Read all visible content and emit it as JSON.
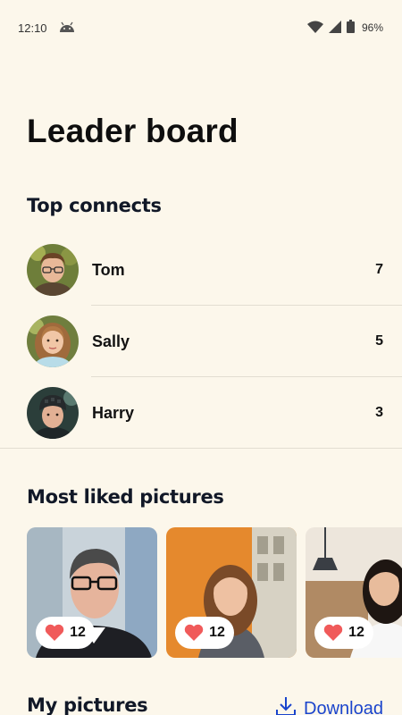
{
  "status_bar": {
    "time": "12:10",
    "battery_percent": "96%",
    "icons": [
      "android-icon",
      "wifi-icon",
      "signal-icon",
      "battery-icon"
    ]
  },
  "page": {
    "title": "Leader board"
  },
  "top_connects": {
    "title": "Top connects",
    "entries": [
      {
        "name": "Tom",
        "count": "7"
      },
      {
        "name": "Sally",
        "count": "5"
      },
      {
        "name": "Harry",
        "count": "3"
      }
    ]
  },
  "most_liked": {
    "title": "Most liked pictures",
    "pictures": [
      {
        "likes": "12"
      },
      {
        "likes": "12"
      },
      {
        "likes": "12"
      }
    ]
  },
  "my_pictures": {
    "title": "My pictures",
    "download_label": "Download"
  },
  "colors": {
    "background": "#FCF7EB",
    "accent": "#1A44CC",
    "heart": "#F05A5A"
  }
}
